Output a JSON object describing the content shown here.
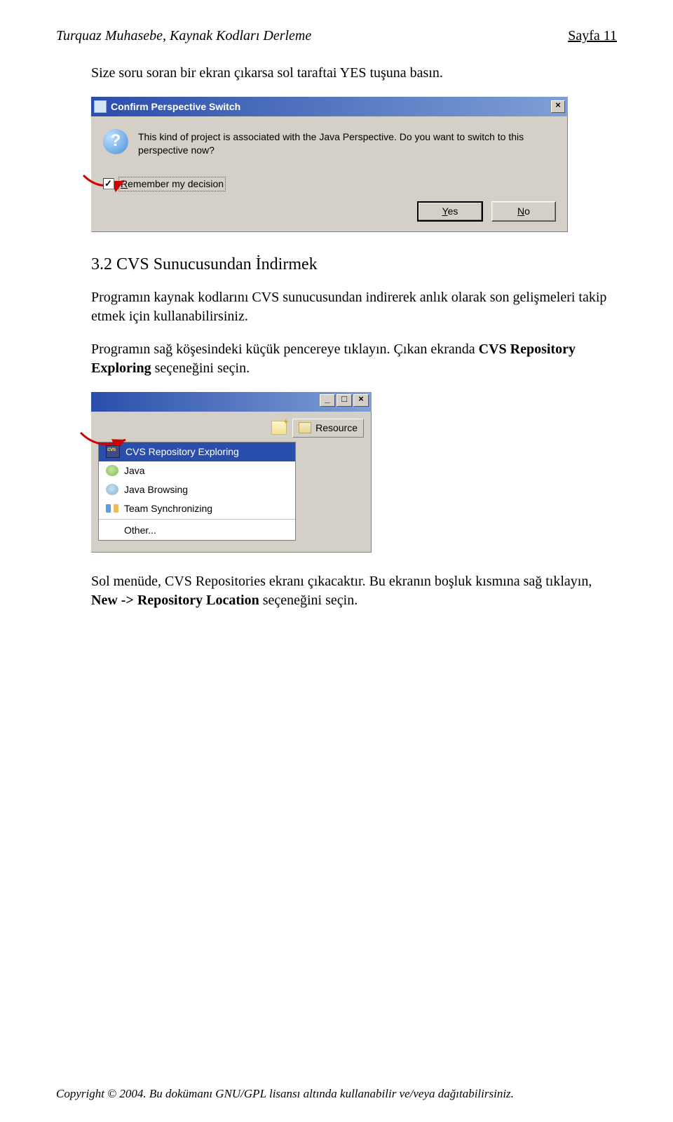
{
  "header": {
    "left": "Turquaz Muhasebe, Kaynak Kodları Derleme",
    "right": "Sayfa 11"
  },
  "intro_para": "Size soru soran bir ekran çıkarsa sol taraftai YES tuşuna basın.",
  "dialog1": {
    "title": "Confirm Perspective Switch",
    "message": "This kind of project is associated with the Java Perspective. Do you want to switch to this perspective now?",
    "remember_prefix": "R",
    "remember_rest": "emember my decision",
    "yes_u": "Y",
    "yes_rest": "es",
    "no_u": "N",
    "no_rest": "o"
  },
  "section_heading": "3.2  CVS Sunucusundan İndirmek",
  "para2": "Programın kaynak kodlarını CVS sunucusundan indirerek anlık olarak son gelişmeleri takip etmek için kullanabilirsiniz.",
  "para3_a": "Programın sağ köşesindeki küçük pencereye tıklayın. Çıkan ekranda ",
  "para3_b": "CVS Repository Exploring",
  "para3_c": " seçeneğini seçin.",
  "dialog2": {
    "resource_label": "Resource",
    "items": {
      "cvs": "CVS Repository Exploring",
      "java": "Java",
      "javab": "Java Browsing",
      "team": "Team Synchronizing",
      "other": "Other..."
    }
  },
  "para4_a": "Sol menüde, CVS Repositories ekranı çıkacaktır. Bu ekranın boşluk kısmına sağ tıklayın, ",
  "para4_b": "New -> Repository Location",
  "para4_c": " seçeneğini seçin.",
  "footer": "Copyright © 2004. Bu dokümanı GNU/GPL lisansı altında kullanabilir ve/veya dağıtabilirsiniz."
}
